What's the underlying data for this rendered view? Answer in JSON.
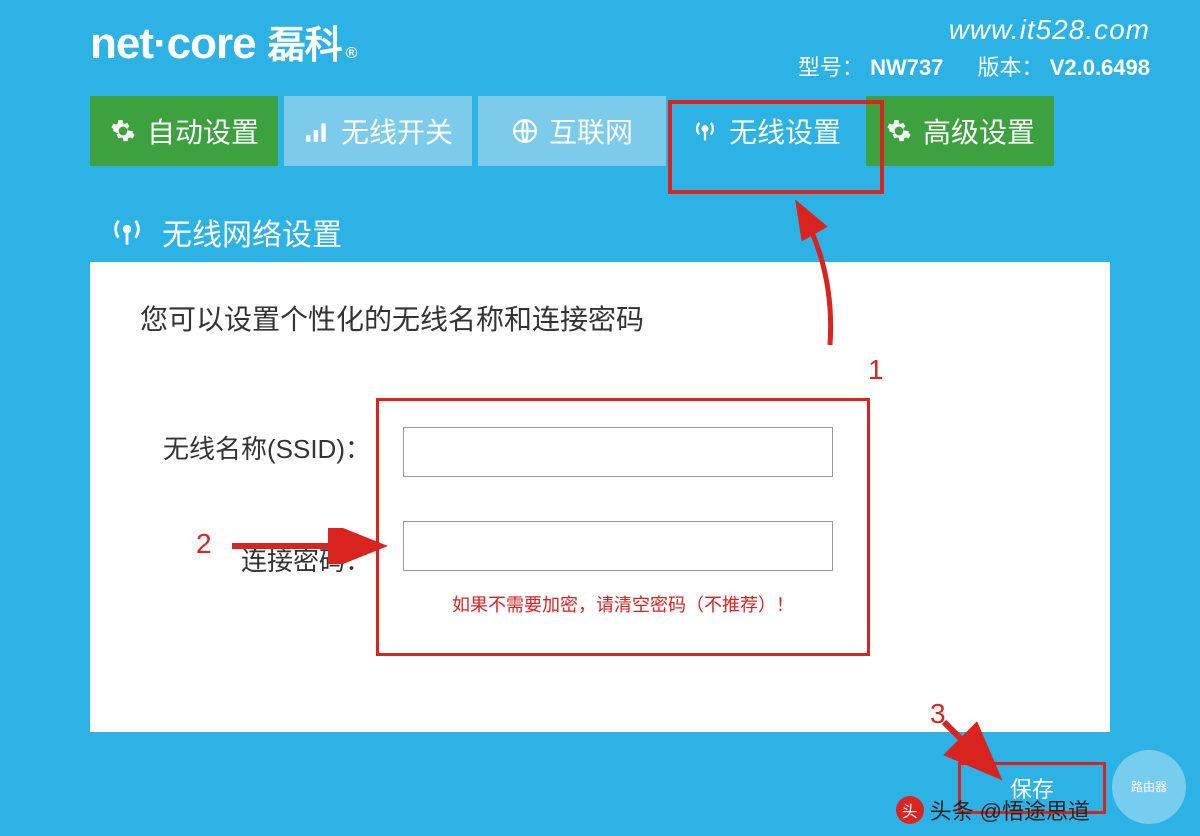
{
  "brand": {
    "en": "net·core",
    "cn": "磊科",
    "reg": "®"
  },
  "site": "www.it528.com",
  "model_label": "型号：",
  "model_value": "NW737",
  "version_label": "版本：",
  "version_value": "V2.0.6498",
  "tabs": {
    "auto": "自动设置",
    "wireless_switch": "无线开关",
    "internet": "互联网",
    "wireless_settings": "无线设置",
    "advanced": "高级设置"
  },
  "panel": {
    "title": "无线网络设置",
    "intro": "您可以设置个性化的无线名称和连接密码",
    "ssid_label": "无线名称(SSID)：",
    "password_label": "连接密码：",
    "hint": "如果不需要加密，请清空密码（不推荐）！",
    "save": "保存"
  },
  "annotations": {
    "n1": "1",
    "n2": "2",
    "n3": "3"
  },
  "footer": {
    "prefix": "头条",
    "handle": "@悟途思道"
  },
  "watermark": "路由器"
}
